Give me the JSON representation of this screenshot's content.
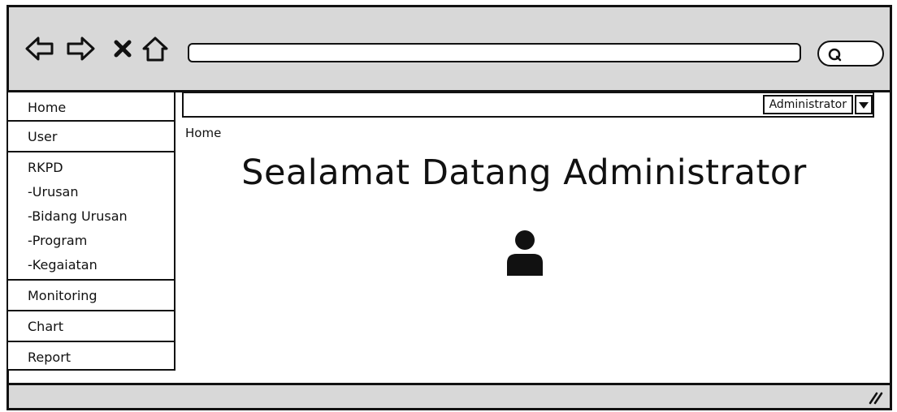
{
  "browser": {
    "nav_icons": [
      "back-arrow-icon",
      "forward-arrow-icon",
      "close-x-icon",
      "home-icon"
    ],
    "address_value": "",
    "search_icon": "search-icon"
  },
  "sidebar": {
    "items": [
      {
        "label": "Home"
      },
      {
        "label": "User"
      },
      {
        "label": "RKPD",
        "subitems": [
          "-Urusan",
          "-Bidang Urusan",
          "-Program",
          "-Kegaiatan"
        ]
      },
      {
        "label": "Monitoring"
      },
      {
        "label": "Chart"
      },
      {
        "label": "Report"
      }
    ]
  },
  "header": {
    "user_menu_label": "Administrator"
  },
  "main": {
    "breadcrumb": "Home",
    "welcome_text": "Sealamat Datang Administrator",
    "avatar_icon": "user-icon"
  }
}
